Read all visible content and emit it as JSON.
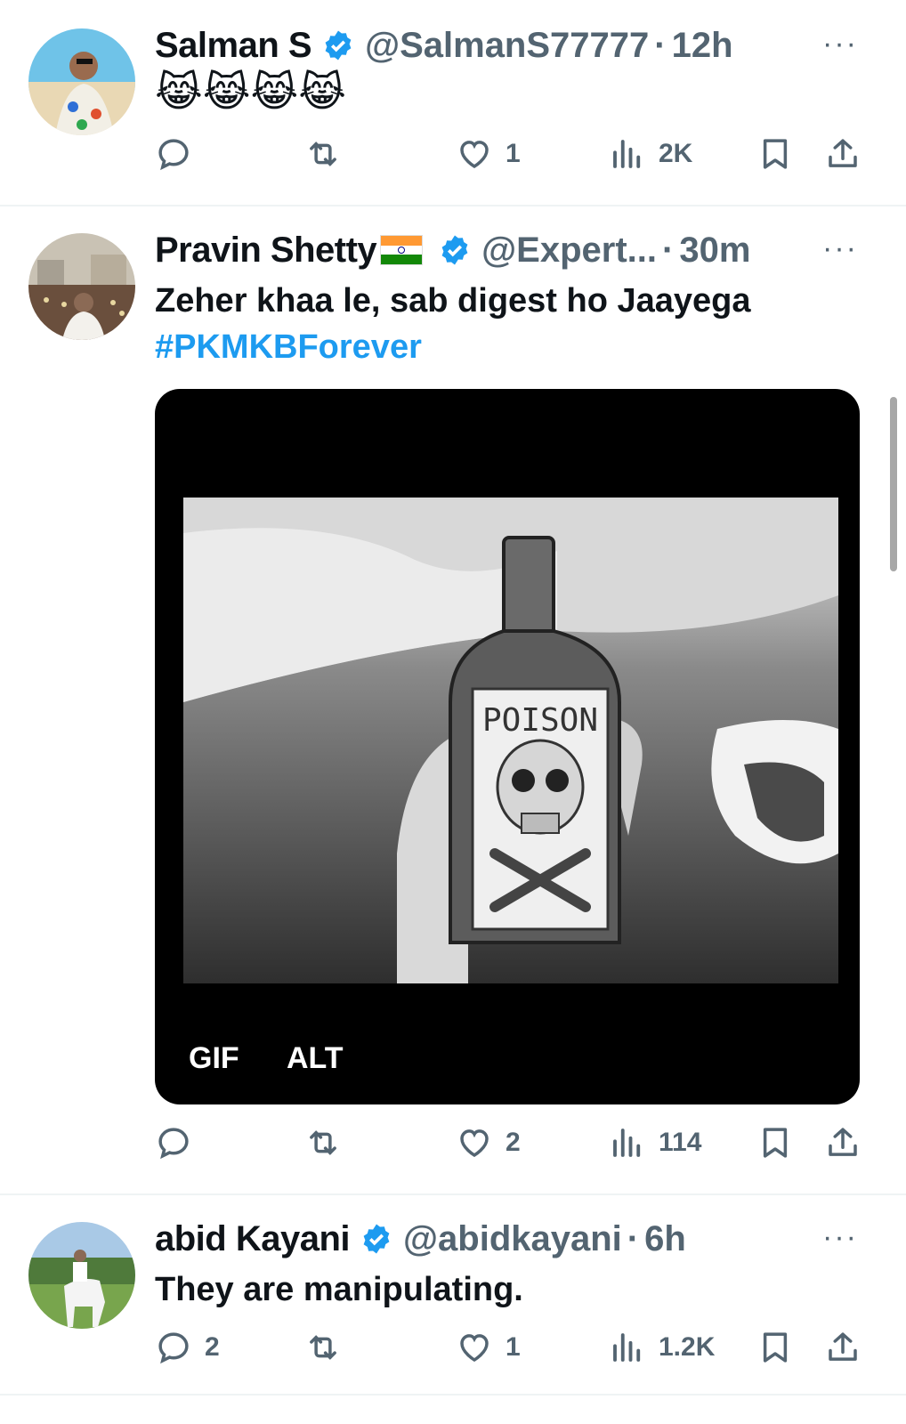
{
  "tweets": [
    {
      "name": "Salman S",
      "handle": "@SalmanS77777",
      "separator": "·",
      "time": "12h",
      "more": "···",
      "text": "😹😹😹😹",
      "stats": {
        "replies": "",
        "retweets": "",
        "likes": "1",
        "views": "2K"
      }
    },
    {
      "name": "Pravin Shetty",
      "handle": "@Expert...",
      "separator": "·",
      "time": "30m",
      "more": "···",
      "text": "Zeher khaa le, sab digest ho Jaayega",
      "hashtag": "#PKMKBForever",
      "media": {
        "gif_label": "GIF",
        "alt_label": "ALT",
        "poison_label": "POISON"
      },
      "stats": {
        "replies": "",
        "retweets": "",
        "likes": "2",
        "views": "114"
      }
    },
    {
      "name": "abid Kayani",
      "handle": "@abidkayani",
      "separator": "·",
      "time": "6h",
      "more": "···",
      "text": "They are manipulating.",
      "stats": {
        "replies": "2",
        "retweets": "",
        "likes": "1",
        "views": "1.2K"
      }
    }
  ],
  "colors": {
    "accent": "#1d9bf0",
    "muted": "#536471",
    "text": "#0f1419"
  }
}
